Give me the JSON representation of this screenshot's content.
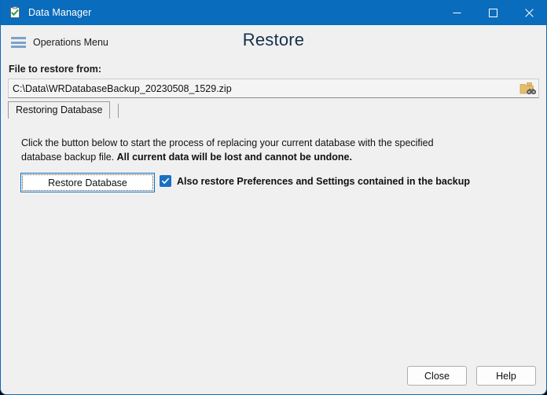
{
  "window": {
    "title": "Data Manager",
    "icon": "clipboard-check-icon",
    "accent_color": "#0a6cbc",
    "background_color": "#f0f0f0",
    "controls": {
      "minimize": "minimize-icon",
      "maximize": "maximize-icon",
      "close": "close-icon"
    }
  },
  "header": {
    "menu_icon": "hamburger-icon",
    "menu_label": "Operations Menu",
    "page_title": "Restore"
  },
  "file_section": {
    "label": "File to restore from:",
    "value": "C:\\Data\\WRDatabaseBackup_20230508_1529.zip",
    "placeholder": "",
    "browse_icon": "folder-browse-icon"
  },
  "tabs": [
    {
      "label": "Restoring Database",
      "selected": true
    }
  ],
  "content": {
    "instruction_part1": "Click the button below to start the process of replacing your current database with the specified database backup file. ",
    "instruction_warning": "All current data will be lost and cannot be undone.",
    "restore_button_label": "Restore Database",
    "checkbox": {
      "label": "Also restore Preferences and Settings contained in the backup",
      "checked": true,
      "check_color": "#1a6fc4"
    }
  },
  "footer": {
    "close_label": "Close",
    "help_label": "Help"
  }
}
